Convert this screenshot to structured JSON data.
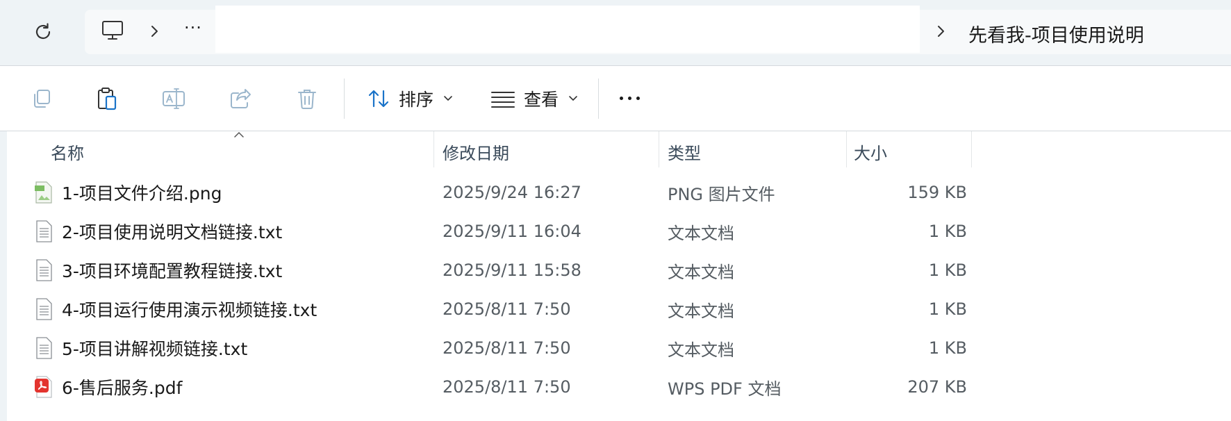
{
  "address_bar": {
    "overflow_label": "···",
    "current_folder": "先看我-项目使用说明"
  },
  "command_bar": {
    "sort_label": "排序",
    "view_label": "查看"
  },
  "columns": {
    "name": "名称",
    "modified": "修改日期",
    "type": "类型",
    "size": "大小"
  },
  "files": [
    {
      "name": "1-项目文件介绍.png",
      "modified": "2025/9/24 16:27",
      "type": "PNG 图片文件",
      "size": "159 KB",
      "icon": "png-file-icon"
    },
    {
      "name": "2-项目使用说明文档链接.txt",
      "modified": "2025/9/11 16:04",
      "type": "文本文档",
      "size": "1 KB",
      "icon": "text-file-icon"
    },
    {
      "name": "3-项目环境配置教程链接.txt",
      "modified": "2025/9/11 15:58",
      "type": "文本文档",
      "size": "1 KB",
      "icon": "text-file-icon"
    },
    {
      "name": "4-项目运行使用演示视频链接.txt",
      "modified": "2025/8/11 7:50",
      "type": "文本文档",
      "size": "1 KB",
      "icon": "text-file-icon"
    },
    {
      "name": "5-项目讲解视频链接.txt",
      "modified": "2025/8/11 7:50",
      "type": "文本文档",
      "size": "1 KB",
      "icon": "text-file-icon"
    },
    {
      "name": "6-售后服务.pdf",
      "modified": "2025/8/11 7:50",
      "type": "WPS PDF 文档",
      "size": "207 KB",
      "icon": "pdf-file-icon"
    }
  ],
  "colors": {
    "accent": "#1a73c8",
    "pdf_red": "#e3342f",
    "address_bg": "#eef3f6"
  }
}
